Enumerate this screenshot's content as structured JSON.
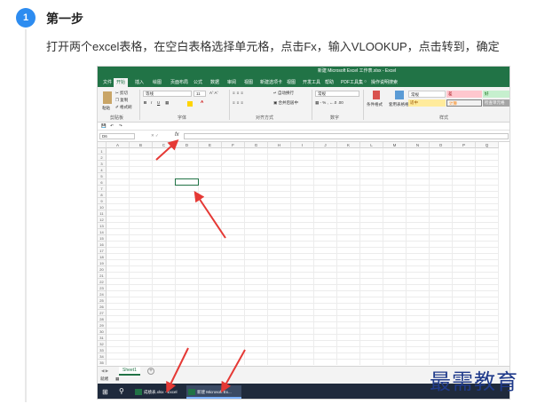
{
  "step": {
    "number": "1",
    "title": "第一步",
    "description": "打开两个excel表格，在空白表格选择单元格，点击Fx，输入VLOOKUP，点击转到，确定"
  },
  "excel": {
    "window_title": "新建 Microsoft Excel 工作表.xlsx - Excel",
    "tabs": [
      "文件",
      "开始",
      "插入",
      "绘图",
      "页面布局",
      "公式",
      "数据",
      "审阅",
      "视图",
      "新建选项卡",
      "视图",
      "开发工具",
      "帮助",
      "PDF工具集",
      "操作说明搜索"
    ],
    "active_tab": "开始",
    "ribbon": {
      "clipboard": {
        "label": "剪贴板",
        "cut": "剪切",
        "copy": "复制",
        "format_painter": "格式刷",
        "paste": "粘贴"
      },
      "font": {
        "label": "字体",
        "name": "等线",
        "size": "11"
      },
      "alignment": {
        "label": "对齐方式",
        "wrap": "自动换行",
        "merge": "合并后居中"
      },
      "number": {
        "label": "数字",
        "format": "常规"
      },
      "styles": {
        "label": "样式",
        "conditional": "条件格式",
        "table": "套用表格格式",
        "normal": "常规",
        "bad": "差",
        "good": "好",
        "neutral": "适中",
        "calc": "计算",
        "check": "检查单元格"
      }
    },
    "name_box": "D6",
    "fx": "fx",
    "columns": [
      "A",
      "B",
      "C",
      "D",
      "E",
      "F",
      "G",
      "H",
      "I",
      "J",
      "K",
      "L",
      "M",
      "N",
      "O",
      "P",
      "Q"
    ],
    "rows": [
      "1",
      "2",
      "3",
      "4",
      "5",
      "6",
      "7",
      "8",
      "9",
      "10",
      "11",
      "12",
      "13",
      "14",
      "15",
      "16",
      "17",
      "18",
      "19",
      "20",
      "21",
      "22",
      "23",
      "24",
      "25",
      "26",
      "27",
      "28",
      "29",
      "30",
      "31",
      "32",
      "33",
      "34",
      "35"
    ],
    "sheet_tab": "Sheet1",
    "status": "就绪",
    "taskbar": {
      "item1": "成绩表.xlsx - Excel",
      "item2": "新建 Microsoft Ex..."
    },
    "colors": {
      "accent": "#217346",
      "taskbar": "#1f2a3c"
    }
  },
  "watermark": "最需教育"
}
